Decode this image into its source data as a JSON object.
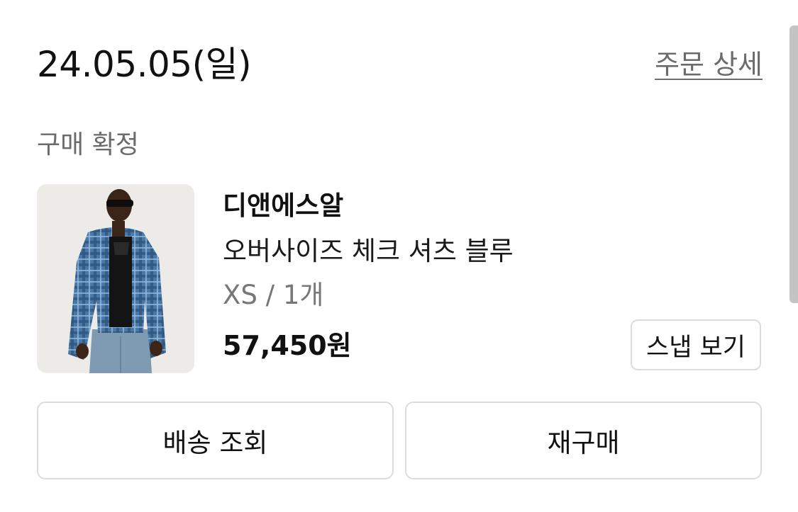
{
  "order": {
    "date": "24.05.05(일)",
    "detail_link": "주문 상세",
    "status": "구매 확정"
  },
  "product": {
    "image_icon": "product-photo-icon",
    "brand": "디앤에스알",
    "name": "오버사이즈 체크 셔츠 블루",
    "option": "XS / 1개",
    "price": "57,450원",
    "snap_label": "스냅 보기"
  },
  "actions": {
    "delivery_label": "배송 조회",
    "reorder_label": "재구매"
  }
}
